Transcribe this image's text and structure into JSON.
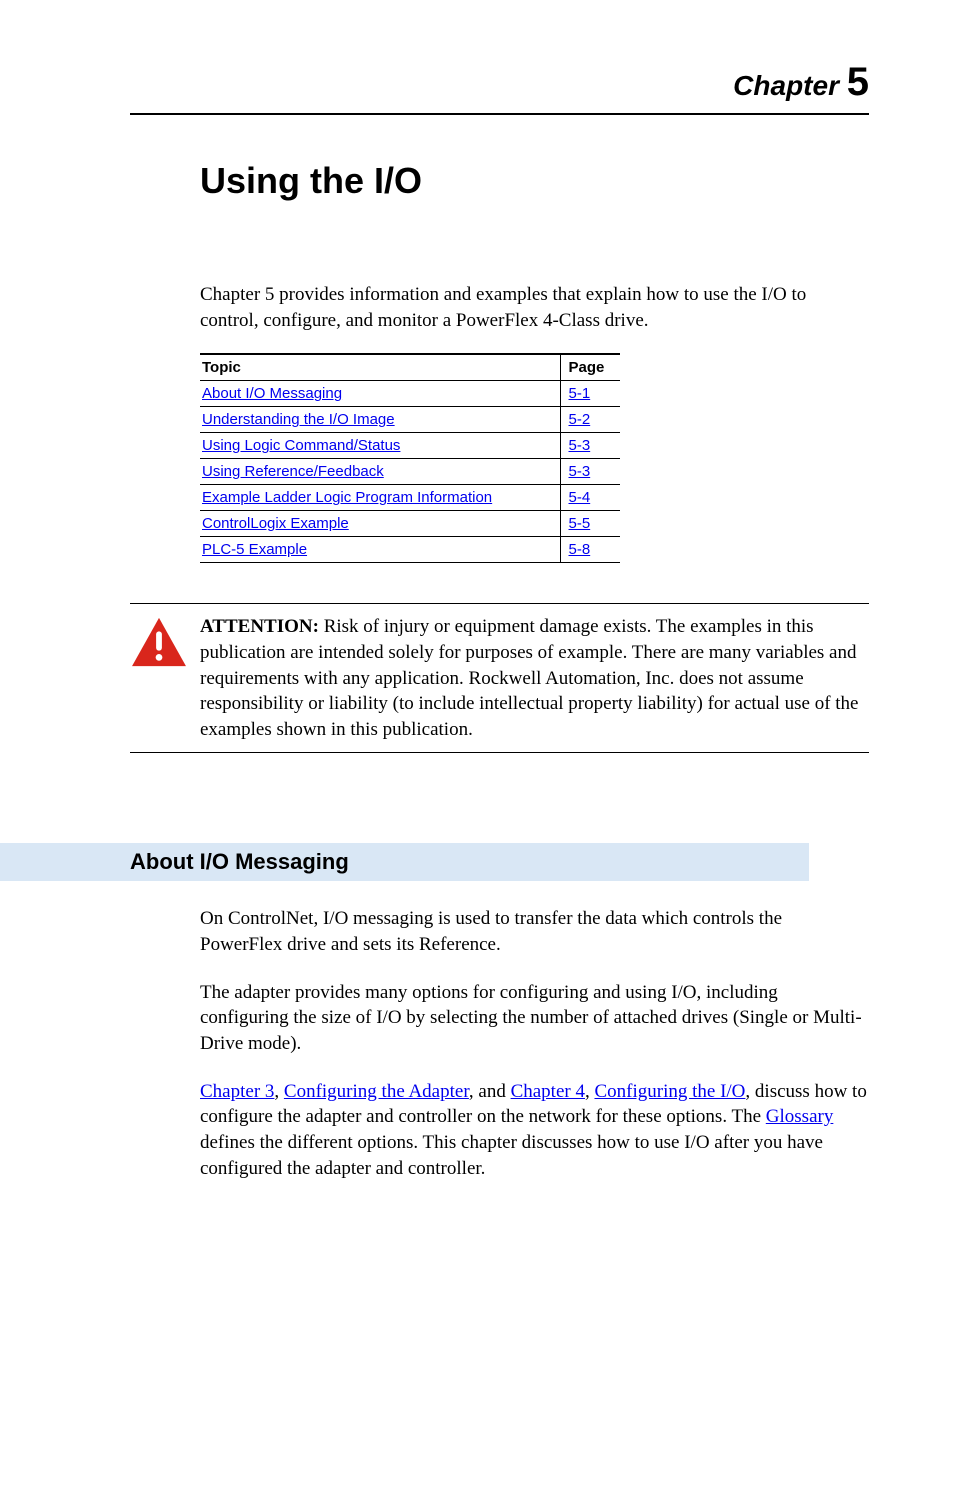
{
  "header": {
    "chapter_word": "Chapter",
    "chapter_number": "5"
  },
  "title": "Using the I/O",
  "intro": "Chapter 5 provides information and examples that explain how to use the I/O to control, configure, and monitor a PowerFlex 4-Class drive.",
  "table": {
    "headers": {
      "topic": "Topic",
      "page": "Page"
    },
    "rows": [
      {
        "topic": "About I/O Messaging",
        "page": "5-1"
      },
      {
        "topic": "Understanding the I/O Image",
        "page": "5-2"
      },
      {
        "topic": "Using Logic Command/Status",
        "page": "5-3"
      },
      {
        "topic": "Using Reference/Feedback",
        "page": "5-3"
      },
      {
        "topic": "Example Ladder Logic Program Information",
        "page": "5-4"
      },
      {
        "topic": "ControlLogix Example",
        "page": "5-5"
      },
      {
        "topic": "PLC-5 Example",
        "page": "5-8"
      }
    ]
  },
  "attention": {
    "label": "ATTENTION:",
    "text": "Risk of injury or equipment damage exists. The examples in this publication are intended solely for purposes of example. There are many variables and requirements with any application. Rockwell Automation, Inc. does not assume responsibility or liability (to include intellectual property liability) for actual use of the examples shown in this publication."
  },
  "section": {
    "heading": "About I/O Messaging",
    "para1": "On ControlNet, I/O messaging is used to transfer the data which controls the PowerFlex drive and sets its Reference.",
    "para2": "The adapter provides many options for configuring and using I/O, including configuring the size of I/O by selecting the number of attached drives (Single or Multi-Drive mode).",
    "para3_parts": {
      "link1": "Chapter 3",
      "sep1": ", ",
      "link2": "Configuring the Adapter",
      "sep2": ", and ",
      "link3": "Chapter 4",
      "sep3": ", ",
      "link4": "Configuring the I/O",
      "sep4": ", discuss how to configure the adapter and controller on the network for these options. The ",
      "link5": "Glossary",
      "sep5": " defines the different options. This chapter discusses how to use I/O after you have configured the adapter and controller."
    }
  }
}
